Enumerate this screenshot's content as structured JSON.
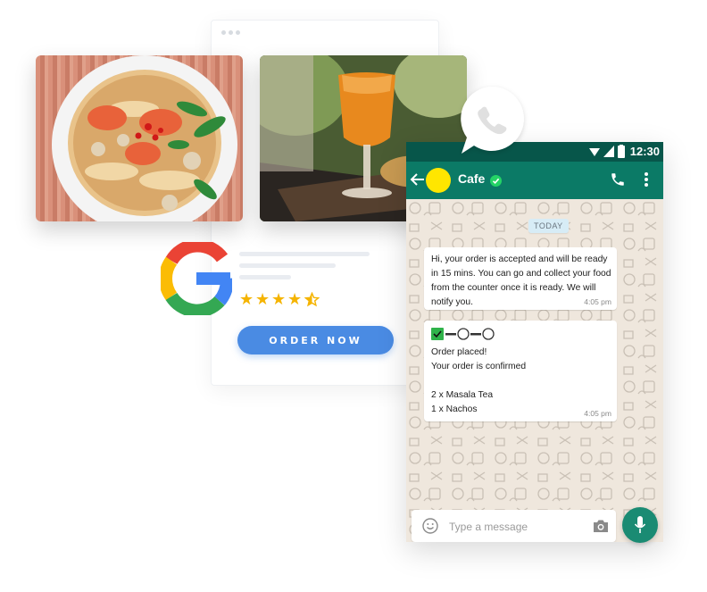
{
  "promo": {
    "rating": {
      "value": 4.5,
      "max": 5
    },
    "order_button": "ORDER NOW"
  },
  "chat": {
    "status_time": "12:30",
    "contact_name": "Cafe",
    "date_label": "TODAY",
    "messages": [
      {
        "text": "Hi, your order is accepted and will be ready in 15 mins. You can go and collect your food from the counter once it is ready. We will notify you.",
        "time": "4:05 pm"
      },
      {
        "text": "Order placed!\nYour order is confirmed\n\n2  x  Masala Tea\n1  x  Nachos",
        "time": "4:05 pm"
      }
    ],
    "input_placeholder": "Type a message"
  },
  "colors": {
    "brand_blue": "#4a8be3",
    "whatsapp_dark": "#07564a",
    "whatsapp_header": "#0b7a66",
    "whatsapp_accent": "#1a8b73",
    "star": "#f5b400"
  },
  "icons": [
    "google-logo-icon",
    "whatsapp-phone-icon",
    "back-arrow-icon",
    "verified-icon",
    "call-icon",
    "menu-icon",
    "emoji-icon",
    "camera-icon",
    "mic-icon",
    "checkbox-icon"
  ]
}
